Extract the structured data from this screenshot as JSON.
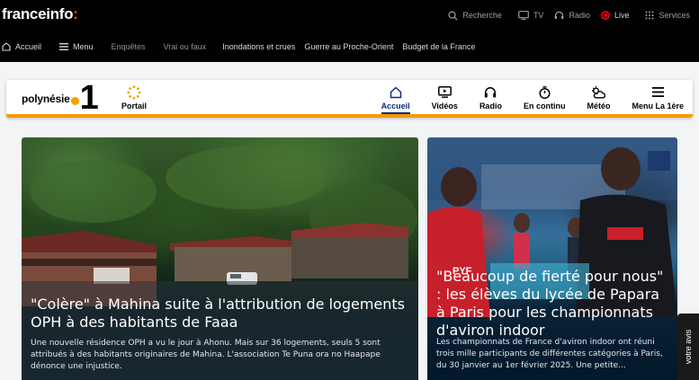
{
  "header": {
    "logo_text": "franceinfo",
    "logo_colon": ":",
    "top_links": [
      {
        "label": "Recherche",
        "icon": "search-icon"
      },
      {
        "label": "TV",
        "icon": "tv-icon"
      },
      {
        "label": "Radio",
        "icon": "headphones-icon"
      },
      {
        "label": "Live",
        "icon": "live-icon"
      },
      {
        "label": "Services",
        "icon": "grid-icon"
      }
    ],
    "nav": {
      "home": "Accueil",
      "menu": "Menu",
      "items": [
        "Enquêtes",
        "Vrai ou faux",
        "Inondations et crues",
        "Guerre au Proche-Orient",
        "Budget de la France"
      ]
    }
  },
  "region": {
    "logo_text": "polynésie",
    "logo_number": "1",
    "portail_label": "Portail",
    "nav": [
      {
        "label": "Accueil",
        "icon": "home-icon",
        "active": true
      },
      {
        "label": "Vidéos",
        "icon": "video-icon",
        "active": false
      },
      {
        "label": "Radio",
        "icon": "headphones-icon",
        "active": false
      },
      {
        "label": "En continu",
        "icon": "stopwatch-icon",
        "active": false
      },
      {
        "label": "Météo",
        "icon": "weather-icon",
        "active": false
      },
      {
        "label": "Menu La 1ère",
        "icon": "hamburger-icon",
        "active": false
      }
    ],
    "accent_color": "#f59b00",
    "active_color": "#0b2d80"
  },
  "articles": [
    {
      "title": "\"Colère\" à Mahina suite à l'attribution de logements OPH à des habitants de Faaa",
      "description": "Une nouvelle résidence OPH a vu le jour à Ahonu. Mais sur 36 logements, seuls 5 sont attribués à des habitants originaires de Mahina. L'association Te Puna ora no Haapape dénonce une injustice."
    },
    {
      "title": "\"Beaucoup de fierté pour nous\" : les élèves du lycée de Papara à Paris pour les championnats d'aviron indoor",
      "description": "Les championnats de France d'aviron indoor ont réuni trois mille participants de différentes catégories à Paris, du 30 janvier au 1er février 2025. Une petite..."
    }
  ],
  "feedback_tab": "votre avis",
  "colors": {
    "brand_orange": "#fe5000",
    "live_red": "#e1000f"
  }
}
